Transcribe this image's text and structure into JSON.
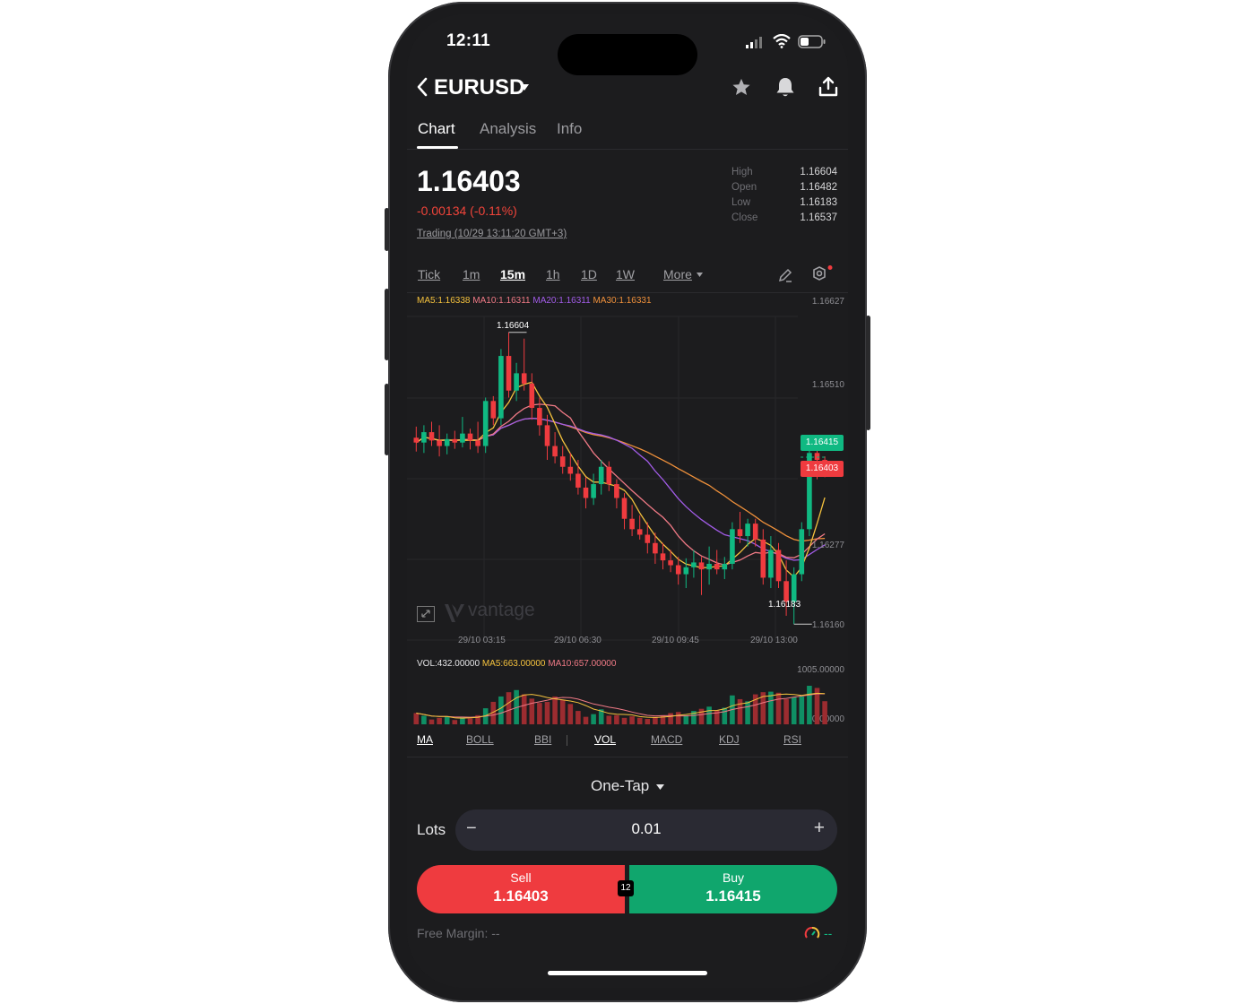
{
  "status_bar": {
    "time": "12:11"
  },
  "header": {
    "symbol": "EURUSD"
  },
  "tabs": [
    {
      "label": "Chart",
      "active": true
    },
    {
      "label": "Analysis",
      "active": false
    },
    {
      "label": "Info",
      "active": false
    }
  ],
  "quote": {
    "price": "1.16403",
    "change": "-0.00134 (-0.11%)",
    "trading_status": "Trading (10/29 13:11:20 GMT+3)",
    "stats": [
      {
        "label": "High",
        "value": "1.16604"
      },
      {
        "label": "Open",
        "value": "1.16482"
      },
      {
        "label": "Low",
        "value": "1.16183"
      },
      {
        "label": "Close",
        "value": "1.16537"
      }
    ]
  },
  "timeframes": {
    "items": [
      "Tick",
      "1m",
      "15m",
      "1h",
      "1D",
      "1W"
    ],
    "active": "15m",
    "more_label": "More"
  },
  "ma_legend": {
    "ma5": "MA5:1.16338",
    "ma10": "MA10:1.16311",
    "ma20": "MA20:1.16311",
    "ma30": "MA30:1.16331"
  },
  "price_axis": [
    "1.16627",
    "1.16510",
    "1.16277",
    "1.16160"
  ],
  "time_axis": [
    "29/10 03:15",
    "29/10 06:30",
    "29/10 09:45",
    "29/10 13:00"
  ],
  "markers": {
    "high": "1.16604",
    "low": "1.16183",
    "ask_tag": "1.16415",
    "bid_tag": "1.16403"
  },
  "watermark": "vantage",
  "volume_legend": {
    "vol": "VOL:432.00000",
    "ma5": "MA5:663.00000",
    "ma10": "MA10:657.00000",
    "axis_top": "1005.00000",
    "axis_bottom": "0.00000"
  },
  "indicators": {
    "items": [
      "MA",
      "BOLL",
      "BBI",
      "VOL",
      "MACD",
      "KDJ",
      "RSI"
    ],
    "active": [
      "MA",
      "VOL"
    ]
  },
  "order": {
    "mode": "One-Tap",
    "lots_label": "Lots",
    "lots_value": "0.01",
    "minus": "−",
    "plus": "+",
    "sell_label": "Sell",
    "sell_price": "1.16403",
    "buy_label": "Buy",
    "buy_price": "1.16415",
    "spread": "12",
    "free_margin": "Free Margin: --",
    "margin_level": "--"
  },
  "colors": {
    "up": "#10b982",
    "down": "#ef3b3f",
    "ma5": "#f5c23d",
    "ma10": "#f07a86",
    "ma20": "#a25ce8",
    "ma30": "#f0913b",
    "background": "#1c1c1e"
  },
  "chart_data": {
    "type": "candlestick",
    "timeframe": "15m",
    "y_range": [
      1.1616,
      1.16627
    ],
    "candles": [
      [
        1.16452,
        1.16468,
        1.16432,
        1.16445
      ],
      [
        1.16445,
        1.1647,
        1.1643,
        1.1646
      ],
      [
        1.1646,
        1.16475,
        1.1644,
        1.16448
      ],
      [
        1.16448,
        1.1647,
        1.16425,
        1.1644
      ],
      [
        1.1644,
        1.16458,
        1.16428,
        1.1645
      ],
      [
        1.1645,
        1.16462,
        1.16436,
        1.16445
      ],
      [
        1.16445,
        1.16482,
        1.16438,
        1.16458
      ],
      [
        1.16458,
        1.16465,
        1.16435,
        1.16448
      ],
      [
        1.16448,
        1.16475,
        1.1643,
        1.1644
      ],
      [
        1.1644,
        1.1651,
        1.1643,
        1.16505
      ],
      [
        1.16505,
        1.16512,
        1.1647,
        1.1648
      ],
      [
        1.1648,
        1.1658,
        1.1647,
        1.1657
      ],
      [
        1.1657,
        1.16604,
        1.1651,
        1.1652
      ],
      [
        1.1652,
        1.1656,
        1.16505,
        1.16545
      ],
      [
        1.16545,
        1.16595,
        1.1652,
        1.1653
      ],
      [
        1.1653,
        1.16545,
        1.16478,
        1.16495
      ],
      [
        1.16495,
        1.1651,
        1.16455,
        1.1647
      ],
      [
        1.1647,
        1.16485,
        1.1642,
        1.1644
      ],
      [
        1.1644,
        1.1646,
        1.16415,
        1.16425
      ],
      [
        1.16425,
        1.1644,
        1.164,
        1.1641
      ],
      [
        1.1641,
        1.1643,
        1.1639,
        1.164
      ],
      [
        1.164,
        1.1642,
        1.1637,
        1.1638
      ],
      [
        1.1638,
        1.16395,
        1.1635,
        1.16365
      ],
      [
        1.16365,
        1.164,
        1.16355,
        1.16385
      ],
      [
        1.16385,
        1.1642,
        1.1637,
        1.1641
      ],
      [
        1.1641,
        1.16418,
        1.16375,
        1.16385
      ],
      [
        1.16385,
        1.16392,
        1.1635,
        1.16365
      ],
      [
        1.16365,
        1.16372,
        1.1632,
        1.16335
      ],
      [
        1.16335,
        1.16355,
        1.1631,
        1.1632
      ],
      [
        1.1632,
        1.1634,
        1.16305,
        1.16312
      ],
      [
        1.16312,
        1.1633,
        1.16285,
        1.163
      ],
      [
        1.163,
        1.16315,
        1.1627,
        1.16285
      ],
      [
        1.16285,
        1.163,
        1.16262,
        1.16275
      ],
      [
        1.16275,
        1.1629,
        1.16258,
        1.16268
      ],
      [
        1.16268,
        1.1628,
        1.1624,
        1.16255
      ],
      [
        1.16255,
        1.16278,
        1.16235,
        1.16265
      ],
      [
        1.16265,
        1.1629,
        1.1625,
        1.16272
      ],
      [
        1.16272,
        1.1628,
        1.16225,
        1.16262
      ],
      [
        1.16262,
        1.16295,
        1.1624,
        1.1627
      ],
      [
        1.1627,
        1.1629,
        1.16255,
        1.16262
      ],
      [
        1.16262,
        1.1628,
        1.16248,
        1.1627
      ],
      [
        1.1627,
        1.1633,
        1.16262,
        1.1632
      ],
      [
        1.1632,
        1.16345,
        1.163,
        1.1631
      ],
      [
        1.1631,
        1.16335,
        1.16295,
        1.16328
      ],
      [
        1.16328,
        1.16335,
        1.16295,
        1.16305
      ],
      [
        1.16305,
        1.1632,
        1.1624,
        1.1625
      ],
      [
        1.1625,
        1.1631,
        1.16235,
        1.1629
      ],
      [
        1.1629,
        1.163,
        1.16235,
        1.16245
      ],
      [
        1.16245,
        1.16275,
        1.16195,
        1.16215
      ],
      [
        1.16215,
        1.16265,
        1.16183,
        1.16255
      ],
      [
        1.16255,
        1.1633,
        1.16245,
        1.1632
      ],
      [
        1.1632,
        1.16448,
        1.1631,
        1.1643
      ],
      [
        1.1643,
        1.16442,
        1.16392,
        1.1642
      ],
      [
        1.1642,
        1.16425,
        1.16395,
        1.16403
      ]
    ],
    "volumes": [
      210,
      160,
      90,
      120,
      150,
      80,
      140,
      110,
      170,
      300,
      420,
      520,
      600,
      640,
      560,
      480,
      400,
      420,
      520,
      460,
      380,
      250,
      140,
      190,
      280,
      160,
      170,
      120,
      150,
      120,
      100,
      140,
      170,
      210,
      230,
      170,
      250,
      290,
      330,
      260,
      310,
      540,
      470,
      430,
      560,
      600,
      610,
      590,
      470,
      510,
      520,
      720,
      680,
      432
    ]
  }
}
